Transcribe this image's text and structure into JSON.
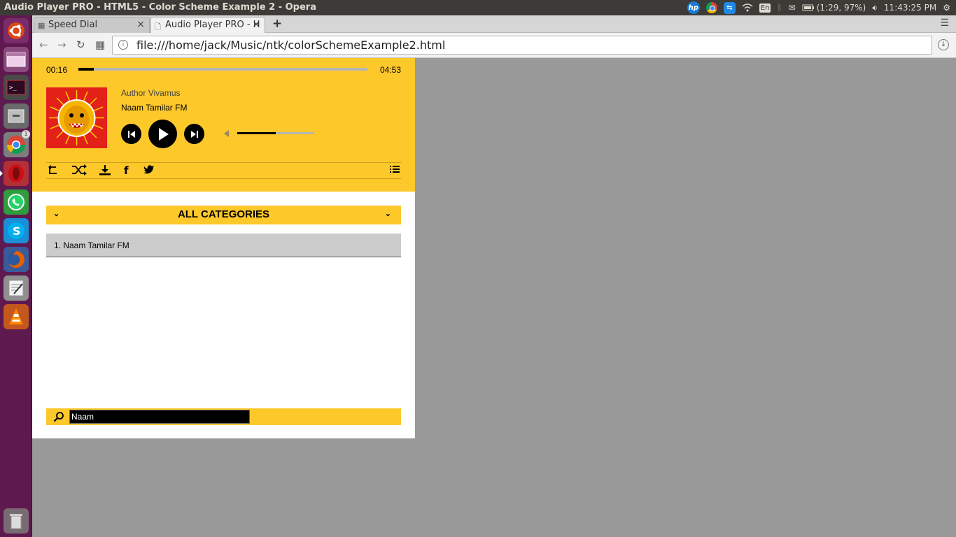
{
  "window": {
    "title": "Audio Player PRO - HTML5 - Color Scheme Example 2 - Opera"
  },
  "tray": {
    "hp": "hp",
    "keyboard": "En",
    "battery": "(1:29, 97%)",
    "clock": "11:43:25 PM"
  },
  "launcher": {
    "items": [
      "ubuntu-home-icon",
      "workspace-icon",
      "terminal-icon",
      "files-icon",
      "chrome-icon",
      "opera-icon",
      "whatsapp-icon",
      "skype-icon",
      "firefox-icon",
      "text-editor-icon",
      "vlc-icon",
      "trash-icon"
    ],
    "chrome_badge": "1"
  },
  "browser": {
    "tabs": [
      {
        "label": "Speed Dial"
      },
      {
        "label": "Audio Player PRO - H"
      }
    ],
    "url": "file:///home/jack/Music/ntk/colorSchemeExample2.html"
  },
  "player": {
    "current_time": "00:16",
    "total_time": "04:53",
    "progress_fraction": 0.054,
    "volume_fraction": 0.5,
    "author": "Author Vivamus",
    "song_title": "Naam Tamilar FM",
    "categories_label": "ALL CATEGORIES",
    "playlist": [
      {
        "label": "1. Naam Tamilar FM"
      }
    ],
    "search_value": "Naam",
    "colors": {
      "accent": "#fdc82a",
      "playlist_bg": "#cccccc"
    }
  }
}
